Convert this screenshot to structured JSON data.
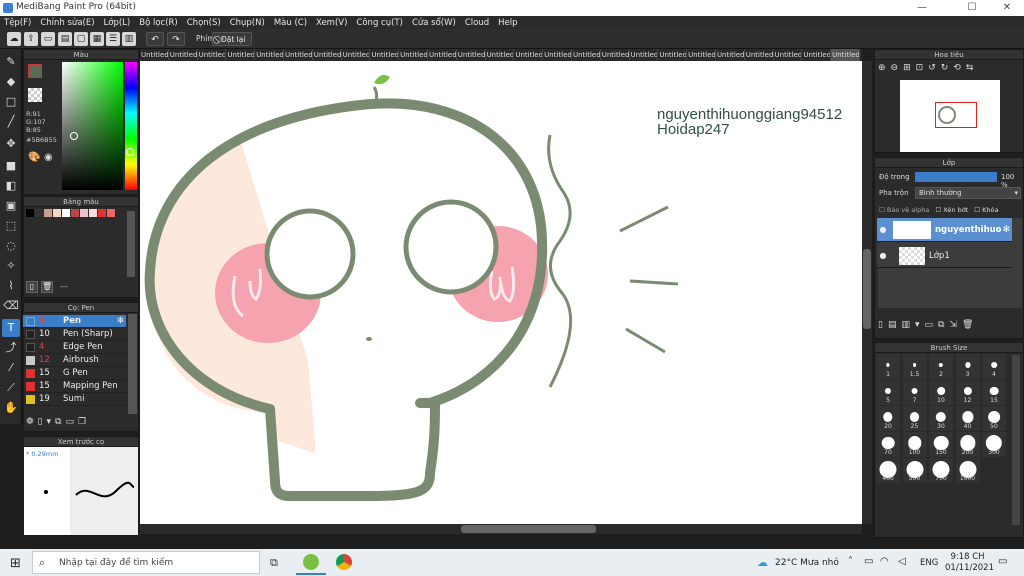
{
  "window": {
    "title": "MediBang Paint Pro (64bit)",
    "minimize": "—",
    "maximize": "☐",
    "close": "✕"
  },
  "menu": [
    "Tệp(F)",
    "Chỉnh sửa(E)",
    "Lớp(L)",
    "Bộ lọc(R)",
    "Chọn(S)",
    "Chụp(N)",
    "Màu (C)",
    "Xem(V)",
    "Công cụ(T)",
    "Cửa sổ(W)",
    "Cloud",
    "Help"
  ],
  "toolbar": {
    "snap_label": "Phím",
    "reset_label": "Đặt lại"
  },
  "color_panel": {
    "title": "Màu",
    "r": "R:91",
    "g": "G:107",
    "b": "B:85",
    "hex": "#5B6B55",
    "main_color": "#5b6b55"
  },
  "palette_panel": {
    "title": "Bảng màu",
    "dashes": "---"
  },
  "brush_panel": {
    "title": "Cọ: Pen",
    "items": [
      {
        "size": "4",
        "name": "Pen",
        "color": "#3a7ec9"
      },
      {
        "size": "10",
        "name": "Pen (Sharp)",
        "color": "#202020"
      },
      {
        "size": "4",
        "name": "Edge Pen",
        "color": "#202020"
      },
      {
        "size": "12",
        "name": "Airbrush",
        "color": "#c9c9c9"
      },
      {
        "size": "15",
        "name": "G Pen",
        "color": "#e03030"
      },
      {
        "size": "15",
        "name": "Mapping Pen",
        "color": "#e03030"
      },
      {
        "size": "19",
        "name": "Sumi",
        "color": "#e0c020"
      }
    ]
  },
  "preview_panel": {
    "title": "Xem trước cọ",
    "size": "* 0.29mm"
  },
  "tabs": [
    "Untitled",
    "Untitled",
    "Untitled",
    "Untitled",
    "Untitled",
    "Untitled",
    "Untitled",
    "Untitled",
    "Untitled",
    "Untitled",
    "Untitled",
    "Untitled",
    "Untitled",
    "Untitled",
    "Untitled",
    "Untitled",
    "Untitled",
    "Untitled",
    "Untitled",
    "Untitled",
    "Untitled",
    "Untitled",
    "Untitled",
    "Untitled",
    "Untitled"
  ],
  "canvas": {
    "text_line1": "nguyenthihuonggiang94512",
    "text_line2": "Hoidap247",
    "stroke_color": "#7b8b72",
    "blush_color": "#f5a3ae",
    "skin_color": "#fde8dc"
  },
  "navigator_panel": {
    "title": "Hoa tiêu"
  },
  "layer_panel": {
    "title": "Lớp",
    "opacity_label": "Độ trong",
    "opacity_value": "100 %",
    "blend_label": "Pha trộn",
    "blend_value": "Bình thường",
    "protect_alpha": "Bảo vệ alpha",
    "clipping": "Xén bớt",
    "lock": "Khóa",
    "layers": [
      {
        "name": "nguyenthihuon"
      },
      {
        "name": "Lớp1"
      }
    ]
  },
  "brush_size_panel": {
    "title": "Brush Size",
    "sizes": [
      "1",
      "1.5",
      "2",
      "3",
      "4",
      "5",
      "7",
      "10",
      "12",
      "15",
      "20",
      "25",
      "30",
      "40",
      "50",
      "70",
      "100",
      "150",
      "200",
      "300",
      "400",
      "500",
      "700",
      "1000"
    ]
  },
  "taskbar": {
    "search_placeholder": "Nhập tại đây để tìm kiếm",
    "weather": "22°C  Mưa nhỏ",
    "lang": "ENG",
    "time": "9:18 CH",
    "date": "01/11/2021"
  }
}
